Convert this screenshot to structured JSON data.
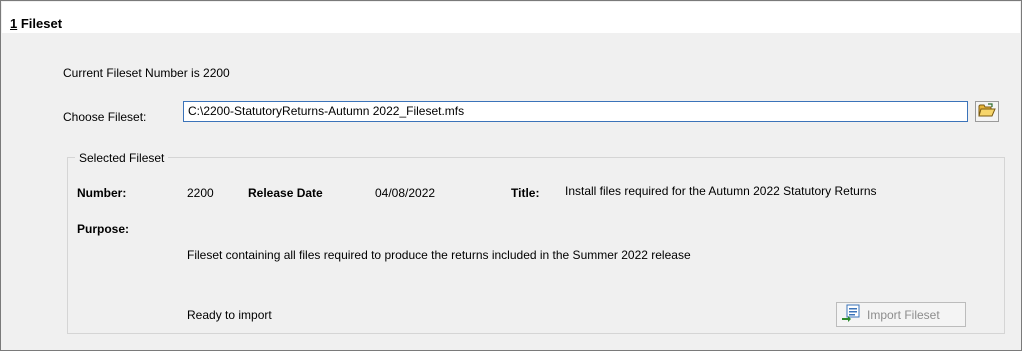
{
  "section": {
    "number": "1",
    "title_rest": " Fileset"
  },
  "current_fileset_text": "Current Fileset Number is 2200",
  "choose": {
    "label": "Choose Fileset:",
    "value": "C:\\2200-StatutoryReturns-Autumn 2022_Fileset.mfs",
    "browse_icon": "open-folder-icon"
  },
  "selected_fileset": {
    "group_title": "Selected Fileset",
    "number_label": "Number:",
    "number_value": "2200",
    "release_date_label": "Release Date",
    "release_date_value": "04/08/2022",
    "title_label": "Title:",
    "title_value": "Install files required for the Autumn 2022 Statutory Returns",
    "purpose_label": "Purpose:",
    "purpose_value": "Fileset containing all files required to produce the returns included in the Summer 2022 release",
    "status_text": "Ready to import"
  },
  "import_button": {
    "label": "Import Fileset",
    "enabled": false,
    "icon": "import-icon"
  },
  "colors": {
    "panel_bg": "#f0f0f0",
    "input_border": "#3b73b9",
    "disabled_text": "#8d8d8d"
  }
}
